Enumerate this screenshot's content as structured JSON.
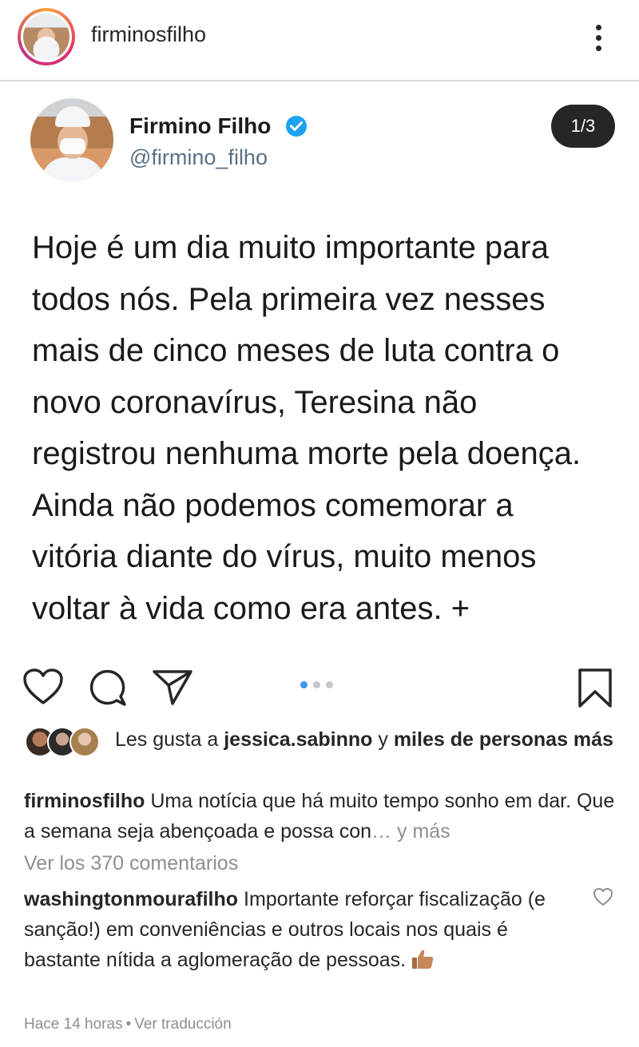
{
  "header": {
    "username": "firminosfilho",
    "avatar_icon": "profile-avatar",
    "menu_icon": "more-options-icon"
  },
  "tweet": {
    "display_name": "Firmino Filho",
    "handle": "@firmino_filho",
    "page_indicator": "1/3",
    "verified_color": "#1da1f2",
    "lines": [
      "Hoje é um dia muito importante para",
      "todos nós. Pela primeira vez nesses",
      "mais de cinco meses de luta contra o",
      "novo coronavírus, Teresina não",
      "registrou nenhuma morte pela doença.",
      "Ainda não podemos comemorar a",
      "vitória diante do vírus, muito menos",
      "voltar à vida como era antes. +"
    ]
  },
  "actions": {
    "icons": [
      "heart-icon",
      "comment-icon",
      "share-icon",
      "bookmark-icon"
    ],
    "carousel_dots": 3,
    "carousel_active": 1,
    "accent_color": "#3897f0"
  },
  "likes": {
    "prefix": "Les gusta a ",
    "user": "jessica.sabinno",
    "middle": " y ",
    "rest": "miles de personas más"
  },
  "caption": {
    "user": "firminosfilho",
    "text": " Uma notícia que há muito tempo sonho em dar. Que a semana seja abençoada e possa con",
    "ellipsis": "…",
    "more": " y más"
  },
  "view_comments": "Ver los 370 comentarios",
  "comment": {
    "user": "washingtonmourafilho",
    "text": " Importante reforçar fiscalização (e sanção!) em conveniências e outros locais nos quais é bastante nítida a aglomeração de pessoas.",
    "time": "Hace 14 horas",
    "separator": "•",
    "translate": "Ver traducción"
  }
}
